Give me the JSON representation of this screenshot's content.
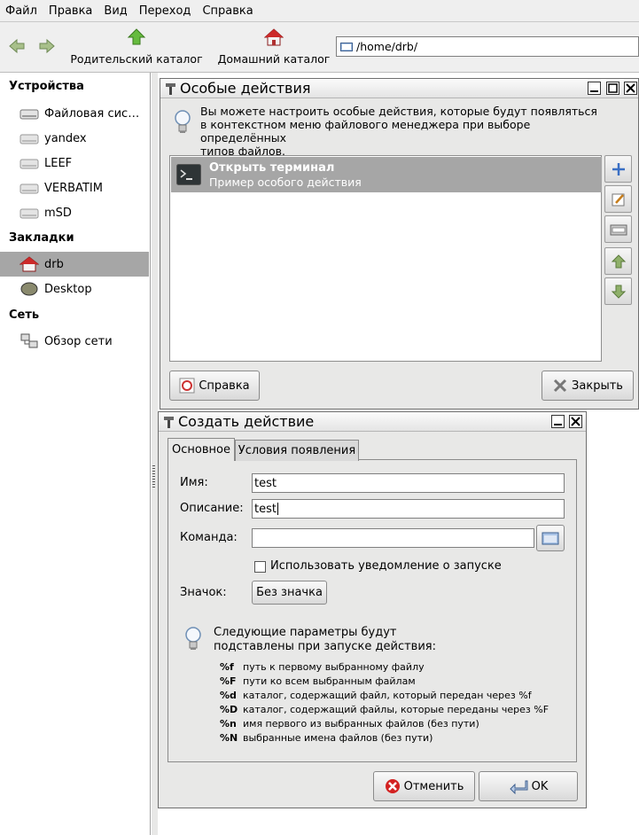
{
  "menubar": {
    "items": [
      "Файл",
      "Правка",
      "Вид",
      "Переход",
      "Справка"
    ]
  },
  "toolbar": {
    "parent_label": "Родительский каталог",
    "home_label": "Домашний каталог",
    "location": "/home/drb/"
  },
  "sidebar": {
    "devices_heading": "Устройства",
    "devices": [
      "Файловая сис…",
      "yandex",
      "LEEF",
      "VERBATIM",
      "mSD"
    ],
    "bookmarks_heading": "Закладки",
    "bookmarks": [
      "drb",
      "Desktop"
    ],
    "network_heading": "Сеть",
    "network": [
      "Обзор сети"
    ]
  },
  "custom_actions": {
    "title": "Особые действия",
    "info": [
      "Вы можете настроить особые действия, которые будут появляться",
      "в контекстном меню файлового менеджера при выборе определённых",
      "типов файлов."
    ],
    "actions": [
      {
        "name": "Открыть терминал",
        "description": "Пример особого действия"
      }
    ],
    "help_label": "Справка",
    "close_label": "Закрыть"
  },
  "create_action": {
    "title": "Создать действие",
    "tabs": [
      "Основное",
      "Условия появления"
    ],
    "name_label": "Имя:",
    "name_value": "test",
    "description_label": "Описание:",
    "description_value": "test",
    "command_label": "Команда:",
    "command_value": "",
    "notify_label": "Использовать уведомление о запуске",
    "notify_checked": false,
    "icon_label": "Значок:",
    "icon_button": "Без значка",
    "params_intro": [
      "Следующие параметры будут",
      "подставлены при запуске действия:"
    ],
    "params": [
      {
        "code": "%f",
        "text": "путь к первому выбранному файлу"
      },
      {
        "code": "%F",
        "text": "пути ко всем выбранным файлам"
      },
      {
        "code": "%d",
        "text": "каталог, содержащий файл, который передан через %f"
      },
      {
        "code": "%D",
        "text": "каталог, содержащий файлы, которые переданы через %F"
      },
      {
        "code": "%n",
        "text": "имя первого из выбранных файлов (без пути)"
      },
      {
        "code": "%N",
        "text": "выбранные имена файлов (без пути)"
      }
    ],
    "cancel_label": "Отменить",
    "ok_label": "OK"
  }
}
